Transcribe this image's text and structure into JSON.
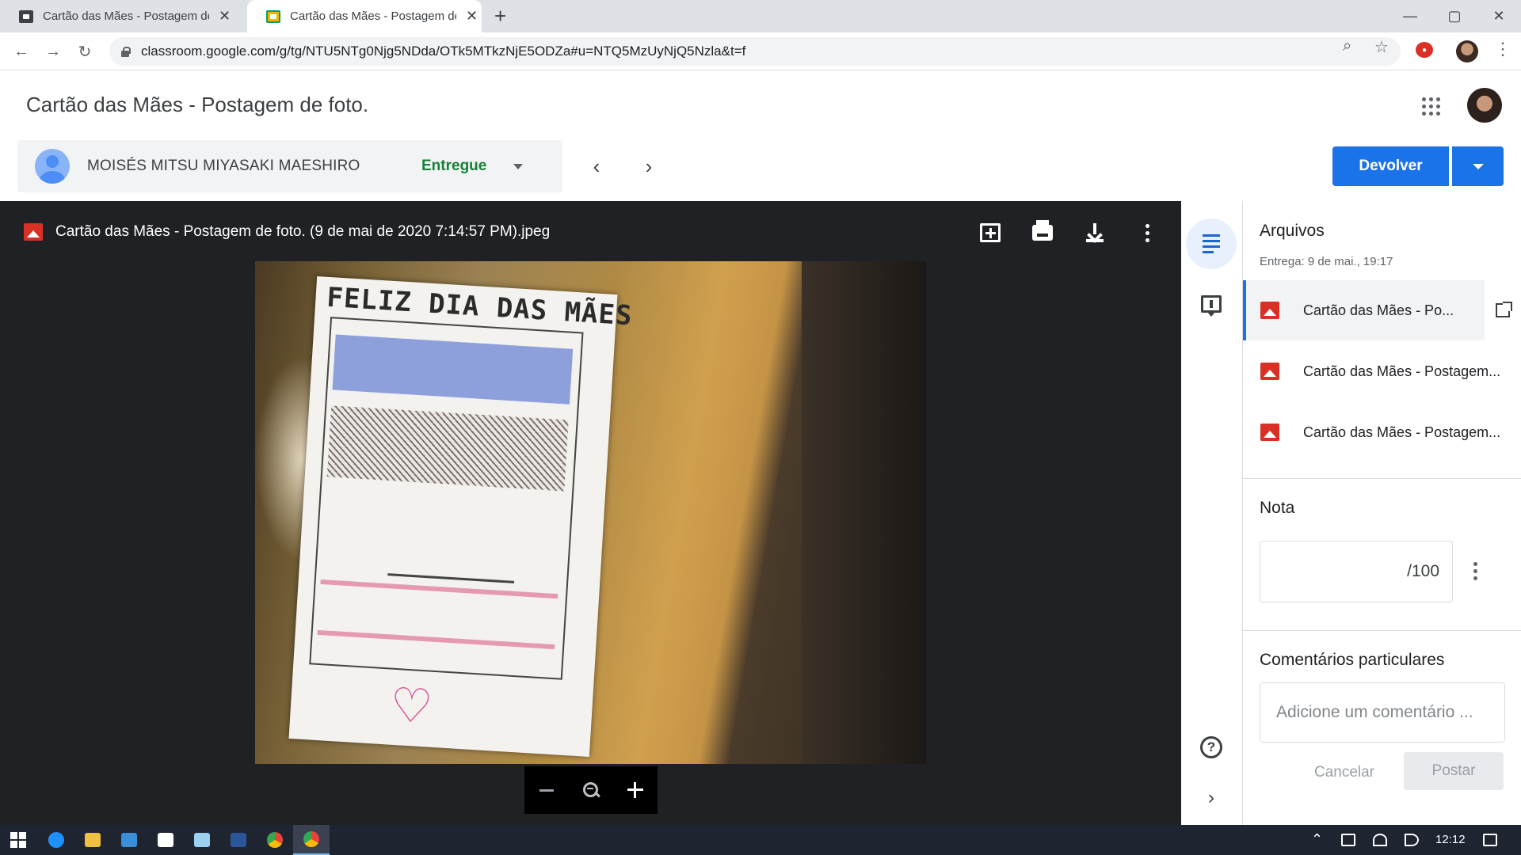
{
  "browser": {
    "tabs": [
      {
        "title": "Cartão das Mães - Postagem de foto.",
        "active": false
      },
      {
        "title": "Cartão das Mães - Postagem de foto.",
        "active": true
      }
    ],
    "url": "classroom.google.com/g/tg/NTU5NTg0Njg5NDda/OTk5MTkzNjE5ODZa#u=NTQ5MzUyNjQ5Nzla&t=f",
    "window_controls": {
      "minimize": "—",
      "maximize": "▢",
      "close": "✕"
    }
  },
  "classroom": {
    "title": "Cartão das Mães - Postagem de foto.",
    "student": {
      "name": "MOISÉS MITSU MIYASAKI MAESHIRO",
      "status": "Entregue"
    },
    "return_button": "Devolver"
  },
  "viewer": {
    "file_name": "Cartão das Mães - Postagem de foto. (9 de mai de 2020 7:14:57 PM).jpeg",
    "photo_card_text": "FELIZ DIA DAS MÃES"
  },
  "panel": {
    "files_title": "Arquivos",
    "submitted_at": "Entrega: 9 de mai., 19:17",
    "files": [
      {
        "name": "Cartão das Mães - Po..."
      },
      {
        "name": "Cartão das Mães - Postagem..."
      },
      {
        "name": "Cartão das Mães - Postagem..."
      }
    ],
    "grade_title": "Nota",
    "grade_max": "/100",
    "comments_title": "Comentários particulares",
    "comment_placeholder": "Adicione um comentário ...",
    "cancel_label": "Cancelar",
    "post_label": "Postar"
  },
  "taskbar": {
    "time": "12:12"
  },
  "colors": {
    "accent": "#1a73e8",
    "status_green": "#188038",
    "file_icon_red": "#d93025",
    "viewer_bg": "#202124"
  }
}
